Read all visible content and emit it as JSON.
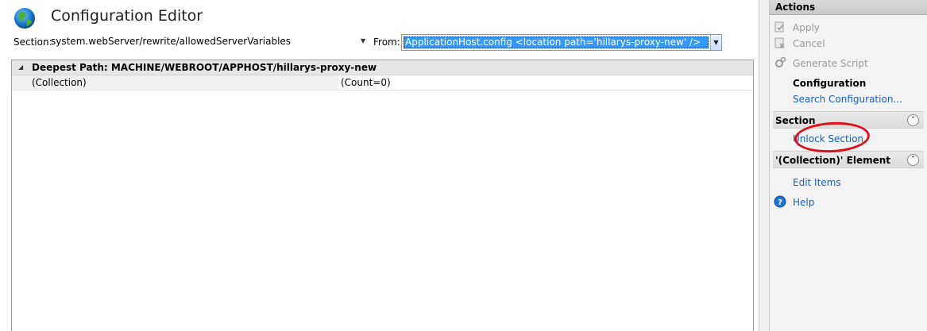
{
  "header": {
    "title": "Configuration Editor",
    "icon": "globe-icon"
  },
  "section_bar": {
    "section_label": "Section:",
    "section_value": "system.webServer/rewrite/allowedServerVariables",
    "from_label": "From:",
    "from_value": "ApplicationHost.config <location path='hillarys-proxy-new' />"
  },
  "grid": {
    "header_path": "Deepest Path: MACHINE/WEBROOT/APPHOST/hillarys-proxy-new",
    "rows": [
      {
        "name": "(Collection)",
        "value": "(Count=0)"
      }
    ]
  },
  "actions": {
    "title": "Actions",
    "apply": "Apply",
    "cancel": "Cancel",
    "generate_script": "Generate Script",
    "configuration": "Configuration",
    "search_configuration": "Search Configuration...",
    "section_group": {
      "title": "Section",
      "unlock_section": "Unlock Section"
    },
    "element_group": {
      "title": "'(Collection)' Element",
      "edit_items": "Edit Items"
    },
    "help": "Help"
  },
  "colors": {
    "selection": "#3399ff",
    "link": "#1a5fbf",
    "annotation": "#e0101b"
  }
}
